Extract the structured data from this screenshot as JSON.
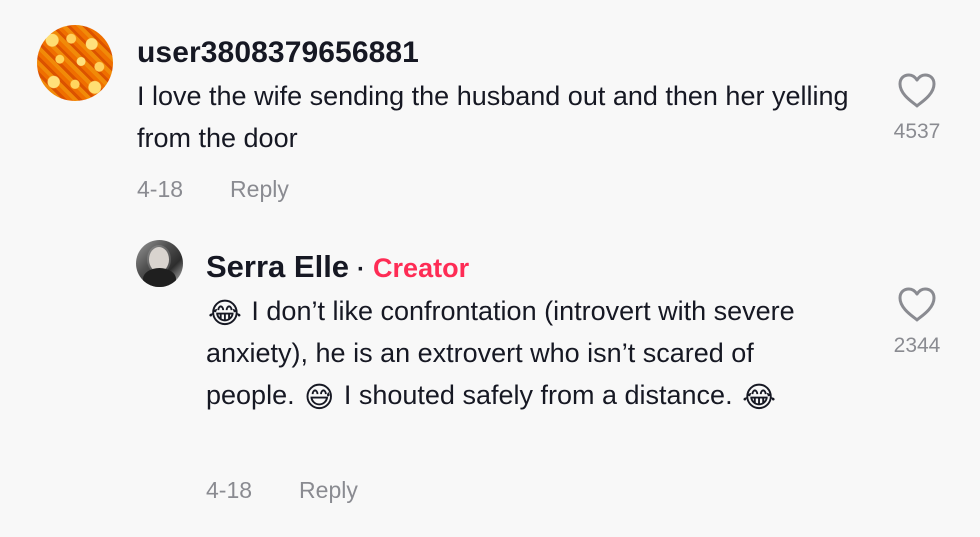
{
  "comments": [
    {
      "username": "user3808379656881",
      "text": "I love the wife sending the husband out and then her yelling from the door",
      "date": "4-18",
      "reply_label": "Reply",
      "like_count": "4537",
      "avatar_icon": "orange-pattern-avatar",
      "like_icon": "heart-outline-icon"
    }
  ],
  "reply": {
    "username": "Serra Elle",
    "separator": "·",
    "badge": "Creator",
    "badge_color": "#fe2c55",
    "emoji_1": "😂",
    "text_1": "I don’t like confrontation (introvert with severe anxiety), he is an extrovert who isn’t scared of people.",
    "emoji_2": "😅",
    "text_2": "I shouted safely from a distance.",
    "emoji_3": "😂",
    "date": "4-18",
    "reply_label": "Reply",
    "like_count": "2344",
    "avatar_icon": "profile-photo-avatar",
    "like_icon": "heart-outline-icon"
  }
}
